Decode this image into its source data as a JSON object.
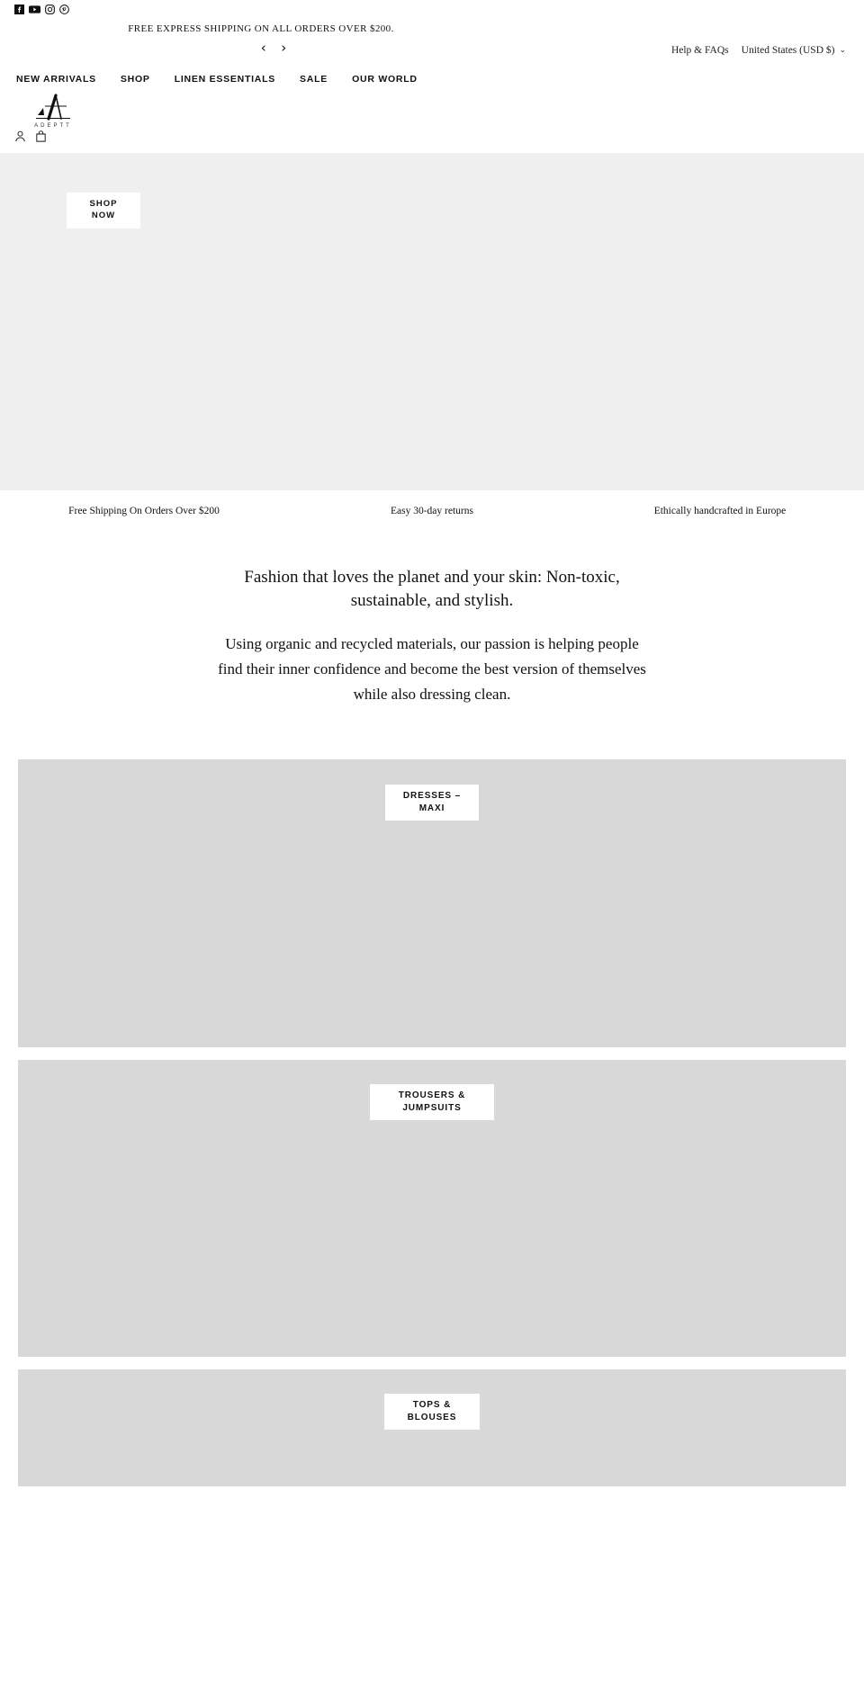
{
  "topbar": {
    "social": [
      {
        "name": "facebook-icon",
        "label": "Facebook"
      },
      {
        "name": "youtube-icon",
        "label": "YouTube"
      },
      {
        "name": "instagram-icon",
        "label": "Instagram"
      },
      {
        "name": "pinterest-icon",
        "label": "Pinterest"
      }
    ],
    "announcement": "FREE EXPRESS SHIPPING ON ALL ORDERS OVER $200.",
    "prev_arrow": "‹",
    "next_arrow": "›",
    "help_link": "Help & FAQs",
    "locale": "United States (USD $)",
    "locale_chevron": "⌄"
  },
  "nav": {
    "items": [
      {
        "label": "NEW ARRIVALS"
      },
      {
        "label": "SHOP"
      },
      {
        "label": "LINEN ESSENTIALS"
      },
      {
        "label": "SALE"
      },
      {
        "label": "OUR WORLD"
      }
    ],
    "logo_word": "ADEPTT",
    "icons": [
      {
        "name": "account-icon",
        "label": "Account"
      },
      {
        "name": "cart-icon",
        "label": "Cart"
      }
    ]
  },
  "hero": {
    "cta": "SHOP NOW",
    "cta_line1": "SHOP",
    "cta_line2": "NOW",
    "background": "#efefef"
  },
  "benefits": [
    {
      "text": "Free Shipping On Orders Over $200"
    },
    {
      "text": "Easy 30-day returns"
    },
    {
      "text": "Ethically handcrafted in Europe"
    }
  ],
  "intro": {
    "heading": "Fashion that loves the planet and your skin: Non-toxic, sustainable, and stylish.",
    "body": "Using organic and recycled materials, our passion is helping people find their inner confidence and become the best version of themselves while also dressing clean."
  },
  "categories": [
    {
      "line1": "DRESSES –",
      "line2": "MAXI"
    },
    {
      "line1": "TROUSERS &",
      "line2": "JUMPSUITS"
    },
    {
      "line1": "TOPS &",
      "line2": "BLOUSES"
    }
  ],
  "colors": {
    "text": "#111111",
    "hero_bg": "#efefef",
    "card_bg": "#d8d8d8",
    "page_bg": "#ffffff"
  }
}
